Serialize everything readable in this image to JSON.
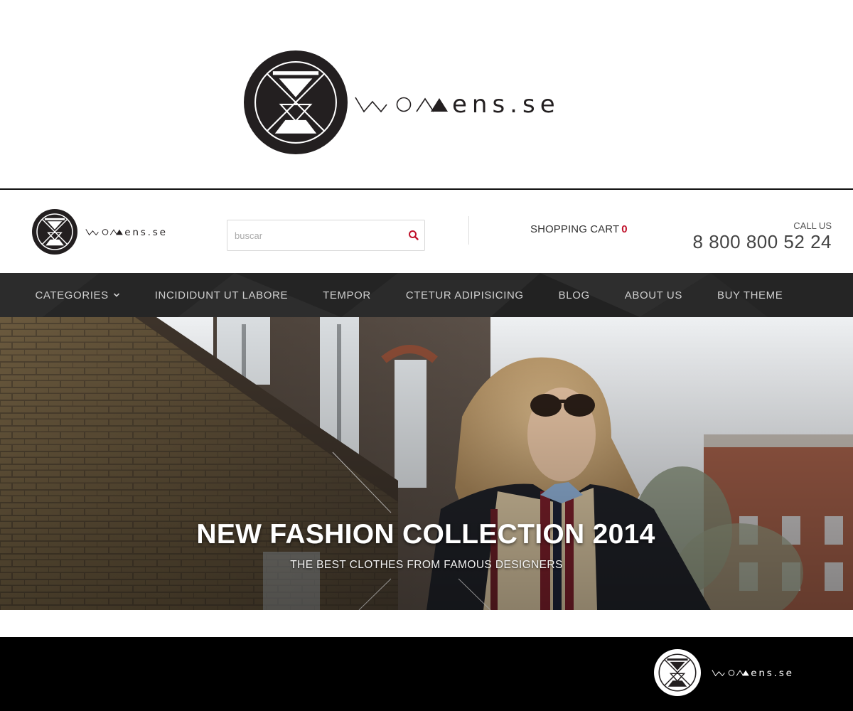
{
  "brand": {
    "name": "womens.se",
    "colors": {
      "dark": "#231f20",
      "accent": "#c0122b",
      "nav_bg": "#2a2a2a",
      "footer_bg": "#000000"
    }
  },
  "header": {
    "search": {
      "placeholder": "buscar",
      "value": "",
      "icon": "search-icon"
    },
    "cart": {
      "label": "SHOPPING CART",
      "count": "0"
    },
    "contact": {
      "label": "CALL US",
      "phone": "8 800 800 52 24"
    }
  },
  "nav": {
    "items": [
      {
        "label": "CATEGORIES",
        "has_dropdown": true,
        "icon": "chevron-down-icon"
      },
      {
        "label": "INCIDIDUNT UT LABORE"
      },
      {
        "label": "TEMPOR"
      },
      {
        "label": "CTETUR ADIPISICING"
      },
      {
        "label": "BLOG"
      },
      {
        "label": "ABOUT US"
      },
      {
        "label": "BUY THEME"
      }
    ]
  },
  "banner": {
    "title": "NEW FASHION COLLECTION 2014",
    "subtitle": "THE BEST CLOTHES FROM FAMOUS DESIGNERS"
  }
}
